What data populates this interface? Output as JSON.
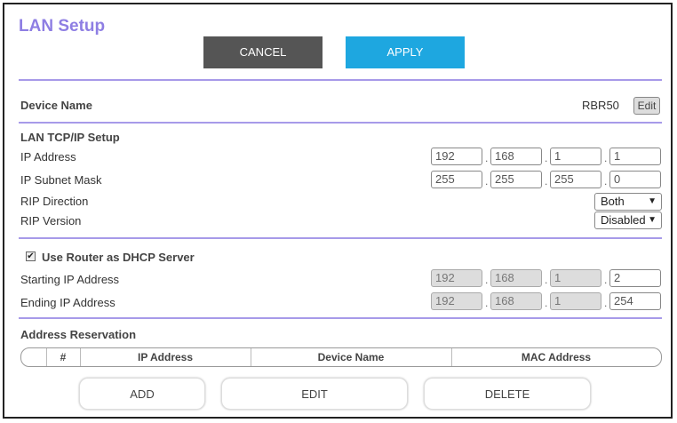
{
  "page": {
    "title": "LAN Setup"
  },
  "actions": {
    "cancel": "CANCEL",
    "apply": "APPLY"
  },
  "device": {
    "label": "Device Name",
    "value": "RBR50",
    "edit": "Edit"
  },
  "tcpip": {
    "heading": "LAN TCP/IP Setup",
    "ip_label": "IP Address",
    "ip": [
      "192",
      "168",
      "1",
      "1"
    ],
    "mask_label": "IP Subnet Mask",
    "mask": [
      "255",
      "255",
      "255",
      "0"
    ],
    "rip_dir_label": "RIP Direction",
    "rip_dir": "Both",
    "rip_ver_label": "RIP Version",
    "rip_ver": "Disabled"
  },
  "dhcp": {
    "checkbox_label": "Use Router as DHCP Server",
    "checked": true,
    "start_label": "Starting IP Address",
    "start": [
      "192",
      "168",
      "1",
      "2"
    ],
    "end_label": "Ending IP Address",
    "end": [
      "192",
      "168",
      "1",
      "254"
    ]
  },
  "reservation": {
    "heading": "Address Reservation",
    "columns": [
      "#",
      "IP Address",
      "Device Name",
      "MAC Address"
    ],
    "add": "ADD",
    "edit": "EDIT",
    "delete": "DELETE"
  }
}
